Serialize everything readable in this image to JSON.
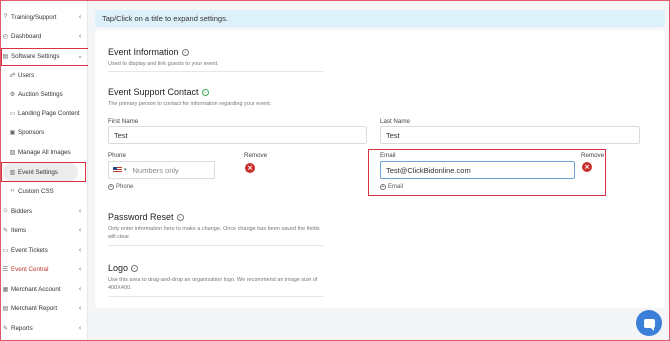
{
  "sidebar": {
    "items": [
      {
        "label": "Training/Support",
        "icon": "help-circle-icon",
        "glyph": "?",
        "chevron": "‹"
      },
      {
        "label": "Dashboard",
        "icon": "dashboard-icon",
        "glyph": "◴",
        "chevron": "‹"
      },
      {
        "label": "Software Settings",
        "icon": "settings-icon",
        "glyph": "▤",
        "chevron": "⌄"
      },
      {
        "label": "Users",
        "icon": "users-icon",
        "glyph": "☍"
      },
      {
        "label": "Auction Settings",
        "icon": "gear-icon",
        "glyph": "⚙"
      },
      {
        "label": "Landing Page Content",
        "icon": "page-icon",
        "glyph": "▭"
      },
      {
        "label": "Sponsors",
        "icon": "sponsors-icon",
        "glyph": "▣"
      },
      {
        "label": "Manage All Images",
        "icon": "image-icon",
        "glyph": "▨"
      },
      {
        "label": "Event Settings",
        "icon": "event-settings-icon",
        "glyph": "▥"
      },
      {
        "label": "Custom CSS",
        "icon": "code-icon",
        "glyph": "‹›"
      },
      {
        "label": "Bidders",
        "icon": "bidders-icon",
        "glyph": "☺",
        "chevron": "‹"
      },
      {
        "label": "Items",
        "icon": "items-icon",
        "glyph": "✎",
        "chevron": "‹"
      },
      {
        "label": "Event Tickets",
        "icon": "ticket-icon",
        "glyph": "▭",
        "chevron": "‹"
      },
      {
        "label": "Event Central",
        "icon": "event-central-icon",
        "glyph": "☰",
        "chevron": "‹"
      },
      {
        "label": "Merchant Account",
        "icon": "merchant-icon",
        "glyph": "▦",
        "chevron": "‹"
      },
      {
        "label": "Merchant Report",
        "icon": "report-icon",
        "glyph": "▤",
        "chevron": "‹"
      },
      {
        "label": "Reports",
        "icon": "reports-icon",
        "glyph": "✎",
        "chevron": "‹"
      }
    ]
  },
  "banner": {
    "text": "Tap/Click on a title to expand settings."
  },
  "sections": {
    "event_info": {
      "title": "Event Information",
      "desc": "Used to display and link guests to your event."
    },
    "support": {
      "title": "Event Support Contact",
      "desc": "The primary person to contact for information regarding your event."
    },
    "password": {
      "title": "Password Reset",
      "desc": "Only enter information here to make a change. Once change has been saved the fields will clear."
    },
    "logo": {
      "title": "Logo",
      "desc": "Use this area to drag-and-drop an organization logo. We recommend an image size of 400X400."
    }
  },
  "form": {
    "first_name_label": "First Name",
    "first_name_value": "Test",
    "last_name_label": "Last Name",
    "last_name_value": "Test",
    "phone_label": "Phone",
    "phone_placeholder": "Numbers only",
    "remove_label": "Remove",
    "add_phone_label": "Phone",
    "email_label": "Email",
    "email_value": "Test@ClickBidonline.com",
    "add_email_label": "Email",
    "remove_glyph": "×",
    "plus_glyph": "+",
    "caret_glyph": "▾",
    "green_caret_glyph": "⌄",
    "collapsed_caret_glyph": "⌄"
  },
  "colors": {
    "accent": "#3b7fd9",
    "highlight": "#d9313f",
    "remove": "#c9302c",
    "banner": "#ddf1fb"
  }
}
